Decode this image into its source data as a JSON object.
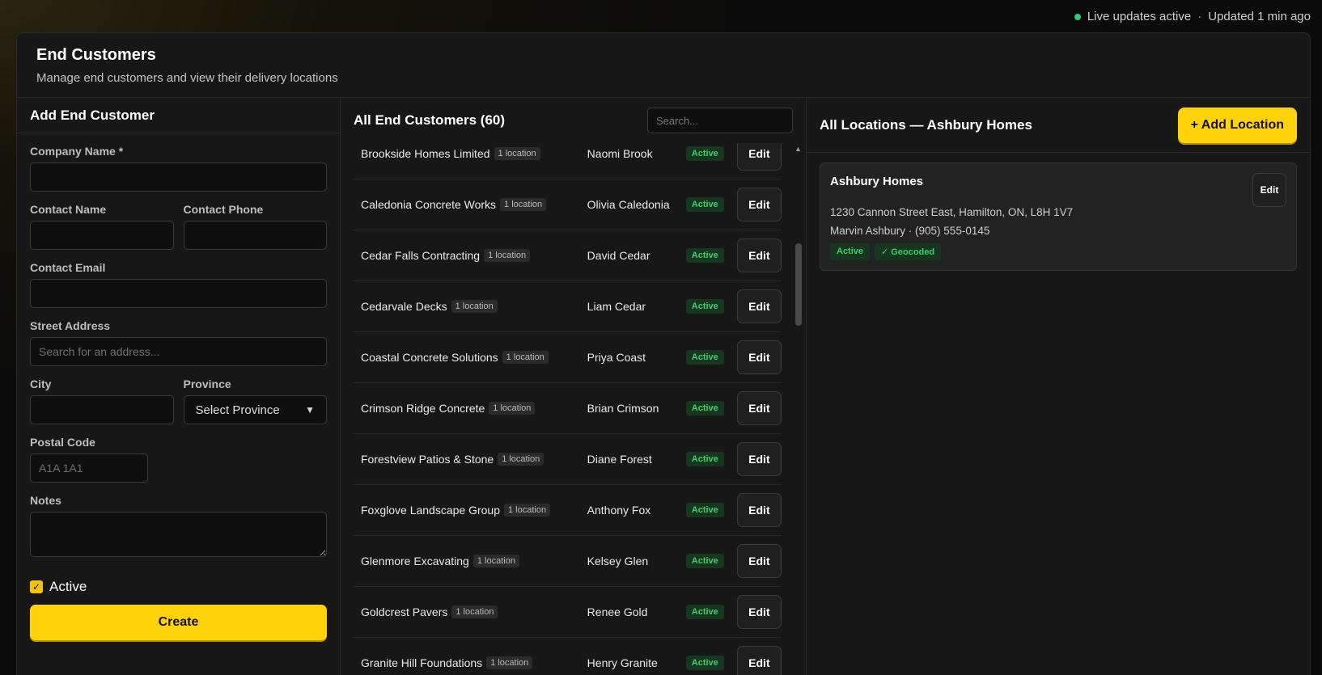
{
  "status_bar": {
    "live_text": "Live updates active",
    "separator": "·",
    "updated_text": "Updated 1 min ago",
    "live_color": "#2ecc71"
  },
  "header": {
    "title": "End Customers",
    "subtitle": "Manage end customers and view their delivery locations"
  },
  "form": {
    "title": "Add End Customer",
    "company_label": "Company Name *",
    "contact_name_label": "Contact Name",
    "contact_phone_label": "Contact Phone",
    "contact_email_label": "Contact Email",
    "street_label": "Street Address",
    "street_placeholder": "Search for an address...",
    "city_label": "City",
    "province_label": "Province",
    "province_selected": "Select Province",
    "postal_label": "Postal Code",
    "postal_placeholder": "A1A 1A1",
    "notes_label": "Notes",
    "active_label": "Active",
    "create_label": "Create"
  },
  "list": {
    "title": "All End Customers (60)",
    "search_placeholder": "Search...",
    "edit_label": "Edit",
    "rows": [
      {
        "company": "Brookside Homes Limited",
        "locations": "1 location",
        "contact": "Naomi Brook",
        "status": "Active"
      },
      {
        "company": "Caledonia Concrete Works",
        "locations": "1 location",
        "contact": "Olivia Caledonia",
        "status": "Active"
      },
      {
        "company": "Cedar Falls Contracting",
        "locations": "1 location",
        "contact": "David Cedar",
        "status": "Active"
      },
      {
        "company": "Cedarvale Decks",
        "locations": "1 location",
        "contact": "Liam Cedar",
        "status": "Active"
      },
      {
        "company": "Coastal Concrete Solutions",
        "locations": "1 location",
        "contact": "Priya Coast",
        "status": "Active"
      },
      {
        "company": "Crimson Ridge Concrete",
        "locations": "1 location",
        "contact": "Brian Crimson",
        "status": "Active"
      },
      {
        "company": "Forestview Patios & Stone",
        "locations": "1 location",
        "contact": "Diane Forest",
        "status": "Active"
      },
      {
        "company": "Foxglove Landscape Group",
        "locations": "1 location",
        "contact": "Anthony Fox",
        "status": "Active"
      },
      {
        "company": "Glenmore Excavating",
        "locations": "1 location",
        "contact": "Kelsey Glen",
        "status": "Active"
      },
      {
        "company": "Goldcrest Pavers",
        "locations": "1 location",
        "contact": "Renee Gold",
        "status": "Active"
      },
      {
        "company": "Granite Hill Foundations",
        "locations": "1 location",
        "contact": "Henry Granite",
        "status": "Active"
      }
    ]
  },
  "locations": {
    "title": "All Locations — Ashbury Homes",
    "add_label": "+ Add Location",
    "card": {
      "name": "Ashbury Homes",
      "address": "1230 Cannon Street East, Hamilton, ON, L8H 1V7",
      "contact": "Marvin Ashbury · (905) 555-0145",
      "status": "Active",
      "geocoded": "✓ Geocoded",
      "edit_label": "Edit"
    }
  },
  "accent_color": "#ffd20a"
}
